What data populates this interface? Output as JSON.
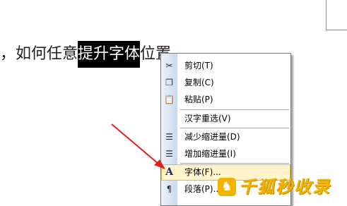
{
  "document": {
    "text_before": "，如何任意",
    "text_selected": "提升字体",
    "text_after": "位置"
  },
  "context_menu": {
    "items": [
      {
        "label": "剪切(T)",
        "icon": "scissors-icon"
      },
      {
        "label": "复制(C)",
        "icon": "copy-icon"
      },
      {
        "label": "粘贴(P)",
        "icon": "paste-icon"
      },
      {
        "label": "汉字重选(V)",
        "icon": ""
      },
      {
        "label": "减少缩进量(D)",
        "icon": "decrease-indent-icon"
      },
      {
        "label": "增加缩进量(I)",
        "icon": "increase-indent-icon"
      },
      {
        "label": "字体(F)...",
        "icon": "font-icon"
      },
      {
        "label": "段落(P)...",
        "icon": "paragraph-icon"
      }
    ],
    "highlighted_index": 6
  },
  "watermark": {
    "text": "千狐秒收录"
  },
  "colors": {
    "selection": "#000000",
    "hover": "#fff4cc",
    "arrow": "#e02020",
    "watermark": "#f0b400"
  }
}
